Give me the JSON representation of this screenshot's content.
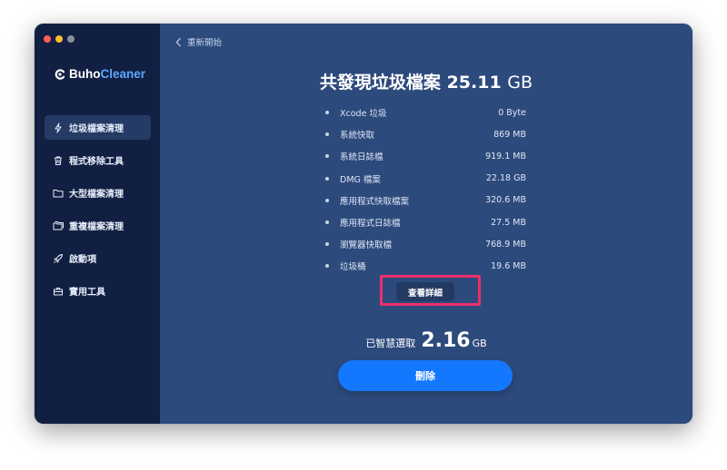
{
  "window": {
    "traffic_lights": [
      {
        "name": "close",
        "color": "#ff5f57"
      },
      {
        "name": "minimize",
        "color": "#febc2e"
      },
      {
        "name": "zoom",
        "color": "#8a8f99"
      }
    ]
  },
  "app": {
    "logo_part1": "Buho",
    "logo_part2": "Cleaner",
    "accent": "#1478ff"
  },
  "sidebar": {
    "items": [
      {
        "label": "垃圾檔案清理",
        "icon": "lightning-icon",
        "active": true
      },
      {
        "label": "程式移除工具",
        "icon": "trash-icon",
        "active": false
      },
      {
        "label": "大型檔案清理",
        "icon": "folder-icon",
        "active": false
      },
      {
        "label": "重複檔案清理",
        "icon": "folders-icon",
        "active": false
      },
      {
        "label": "啟動項",
        "icon": "rocket-icon",
        "active": false
      },
      {
        "label": "實用工具",
        "icon": "toolbox-icon",
        "active": false
      }
    ]
  },
  "header": {
    "back_label": "重新開始"
  },
  "summary": {
    "title_prefix": "共發現垃圾檔案",
    "total_value": "25.11",
    "total_unit": "GB"
  },
  "junk_items": [
    {
      "name": "Xcode 垃圾",
      "size": "0 Byte"
    },
    {
      "name": "系統快取",
      "size": "869 MB"
    },
    {
      "name": "系統日誌檔",
      "size": "919.1 MB"
    },
    {
      "name": "DMG 檔案",
      "size": "22.18 GB"
    },
    {
      "name": "應用程式快取檔案",
      "size": "320.6 MB"
    },
    {
      "name": "應用程式日誌檔",
      "size": "27.5 MB"
    },
    {
      "name": "瀏覽器快取檔",
      "size": "768.9 MB"
    },
    {
      "name": "垃圾桶",
      "size": "19.6 MB"
    }
  ],
  "details_button": {
    "label": "查看詳細"
  },
  "selected": {
    "label": "已智慧選取",
    "value": "2.16",
    "unit": "GB"
  },
  "delete_button": {
    "label": "刪除"
  }
}
